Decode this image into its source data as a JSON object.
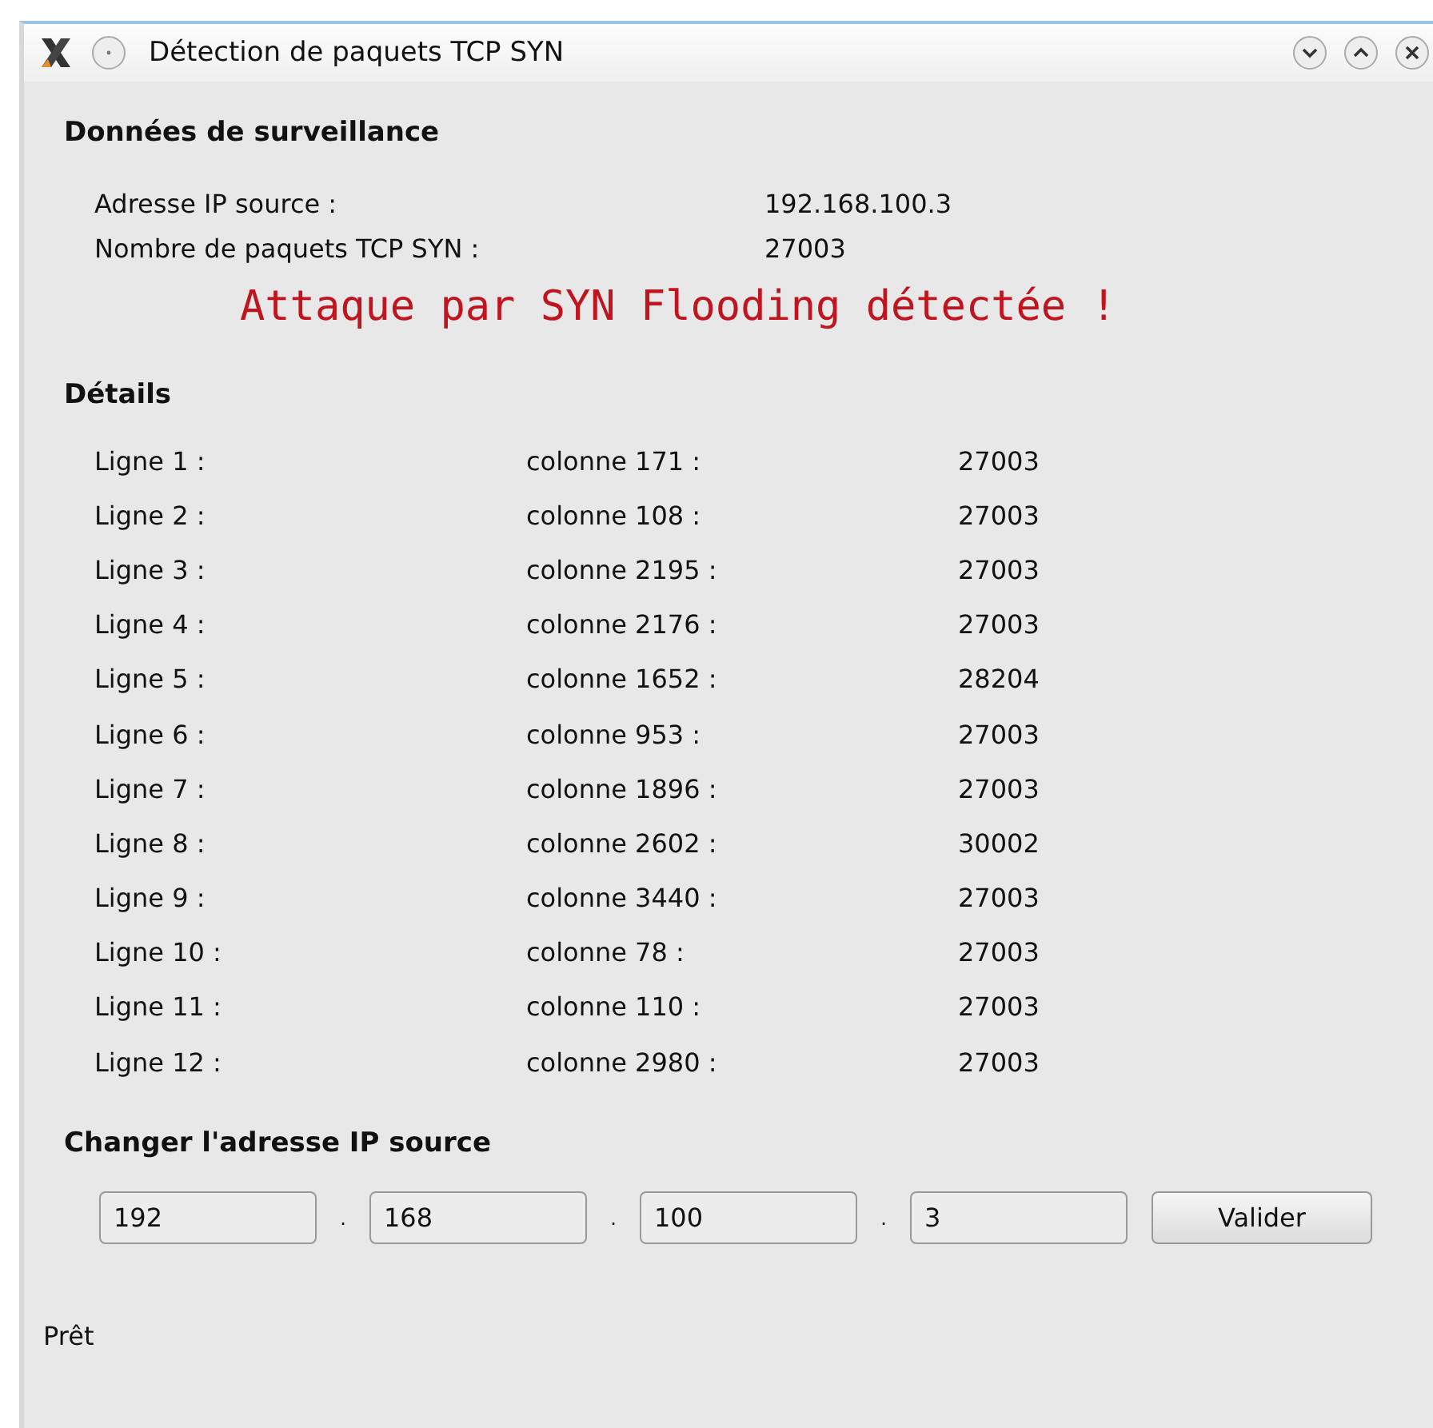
{
  "window": {
    "title": "Détection de paquets TCP SYN"
  },
  "monitoring": {
    "title": "Données de surveillance",
    "rows": [
      {
        "label": "Adresse IP source :",
        "value": "192.168.100.3"
      },
      {
        "label": "Nombre de paquets TCP SYN :",
        "value": "27003"
      }
    ],
    "alert": "Attaque par SYN Flooding détectée !"
  },
  "details": {
    "title": "Détails",
    "rows": [
      {
        "line": "Ligne 1 :",
        "column": "colonne 171 :",
        "value": "27003"
      },
      {
        "line": "Ligne 2 :",
        "column": "colonne 108 :",
        "value": "27003"
      },
      {
        "line": "Ligne 3 :",
        "column": "colonne 2195 :",
        "value": "27003"
      },
      {
        "line": "Ligne 4 :",
        "column": "colonne 2176 :",
        "value": "27003"
      },
      {
        "line": "Ligne 5 :",
        "column": "colonne 1652 :",
        "value": "28204"
      },
      {
        "line": "Ligne 6 :",
        "column": "colonne 953 :",
        "value": "27003"
      },
      {
        "line": "Ligne 7 :",
        "column": "colonne 1896 :",
        "value": "27003"
      },
      {
        "line": "Ligne 8 :",
        "column": "colonne 2602 :",
        "value": "30002"
      },
      {
        "line": "Ligne 9 :",
        "column": "colonne 3440 :",
        "value": "27003"
      },
      {
        "line": "Ligne 10 :",
        "column": "colonne 78 :",
        "value": "27003"
      },
      {
        "line": "Ligne 11 :",
        "column": "colonne 110 :",
        "value": "27003"
      },
      {
        "line": "Ligne 12 :",
        "column": "colonne 2980 :",
        "value": "27003"
      }
    ]
  },
  "change_ip": {
    "title": "Changer l'adresse IP source",
    "fields": [
      "192",
      "168",
      "100",
      "3"
    ],
    "separator": ".",
    "button": "Valider"
  },
  "status_bar": "Prêt"
}
